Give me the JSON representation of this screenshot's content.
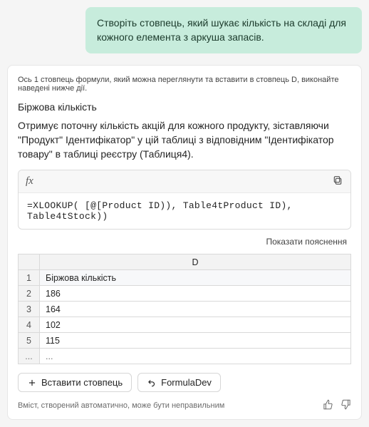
{
  "user_prompt": "Створіть стовпець, який шукає кількість на складі для кожного елемента з аркуша запасів.",
  "response": {
    "intro": "Ось 1 стовпець формули, який можна переглянути та вставити в стовпець D, виконайте наведені нижче дії.",
    "column_title": "Біржова кількість",
    "description": "Отримує поточну кількість акцій для кожного продукту, зіставляючи \"Продукт\" Ідентифікатор\" у цій таблиці з відповідним \"Ідентифікатор товару\" в таблиці реєстру (Таблиця4).",
    "fx_label": "fx",
    "formula": "=XLOOKUP( [@[Product ID)), Table4tProduct       ID), Table4tStock))",
    "explain_label": "Показати пояснення",
    "preview": {
      "col_letter": "D",
      "header": "Біржова кількість",
      "rows": [
        {
          "n": "1",
          "v": "Біржова кількість"
        },
        {
          "n": "2",
          "v": "186"
        },
        {
          "n": "3",
          "v": "164"
        },
        {
          "n": "4",
          "v": "102"
        },
        {
          "n": "5",
          "v": "115"
        },
        {
          "n": "...",
          "v": "..."
        }
      ]
    },
    "insert_button": "Вставити стовпець",
    "formula_dev": "FormulaDev",
    "disclaimer": "Вміст, створений автоматично, може бути неправильним"
  },
  "chart_data": {
    "type": "table",
    "title": "Біржова кількість",
    "columns": [
      "D"
    ],
    "rows": [
      [
        "Біржова кількість"
      ],
      [
        186
      ],
      [
        164
      ],
      [
        102
      ],
      [
        115
      ]
    ]
  }
}
